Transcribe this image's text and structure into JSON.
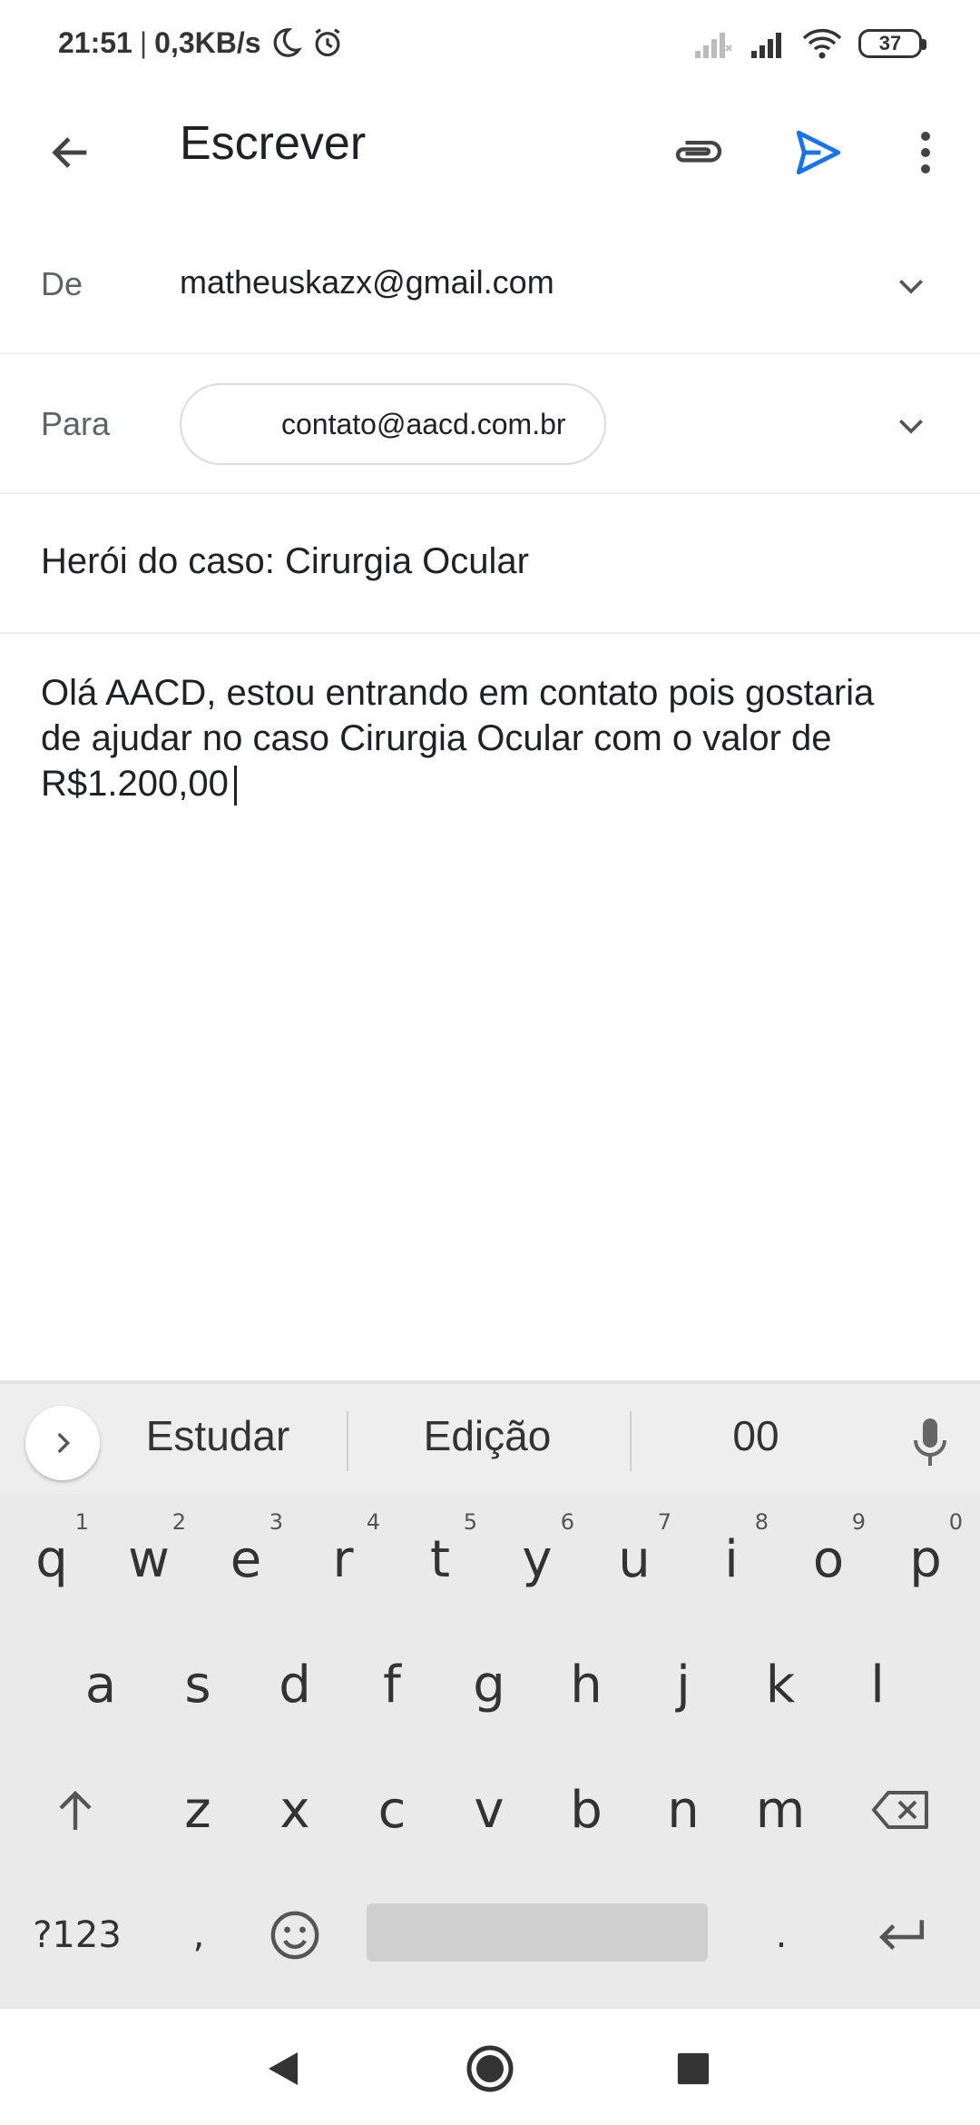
{
  "status_bar": {
    "time": "21:51",
    "separator": "|",
    "net_speed": "0,3KB/s",
    "battery": "37",
    "icons": [
      "moon-icon",
      "alarm-icon",
      "signal-off-icon",
      "signal-icon",
      "wifi-icon",
      "battery-icon"
    ]
  },
  "app_bar": {
    "title": "Escrever",
    "icons": [
      "back-arrow-icon",
      "paperclip-icon",
      "send-icon",
      "more-vert-icon"
    ],
    "send_color": "#1a73e8"
  },
  "compose": {
    "from_label": "De",
    "from_value": "matheuskazx@gmail.com",
    "to_label": "Para",
    "to_chip": "contato@aacd.com.br",
    "subject": "Herói do caso: Cirurgia Ocular",
    "body_line_1": "Olá AACD, estou entrando em contato pois gostaria",
    "body_line_2": "de ajudar no caso Cirurgia Ocular com o valor de",
    "body_line_3": "R$1.200,00"
  },
  "keyboard": {
    "suggestions": [
      "Estudar",
      "Edição",
      "00"
    ],
    "row1": [
      {
        "key": "q",
        "hint": "1"
      },
      {
        "key": "w",
        "hint": "2"
      },
      {
        "key": "e",
        "hint": "3"
      },
      {
        "key": "r",
        "hint": "4"
      },
      {
        "key": "t",
        "hint": "5"
      },
      {
        "key": "y",
        "hint": "6"
      },
      {
        "key": "u",
        "hint": "7"
      },
      {
        "key": "i",
        "hint": "8"
      },
      {
        "key": "o",
        "hint": "9"
      },
      {
        "key": "p",
        "hint": "0"
      }
    ],
    "row2": [
      "a",
      "s",
      "d",
      "f",
      "g",
      "h",
      "j",
      "k",
      "l"
    ],
    "row3": [
      "z",
      "x",
      "c",
      "v",
      "b",
      "n",
      "m"
    ],
    "symbols_key": "?123",
    "comma_key": ",",
    "period_key": "."
  },
  "nav_bar": {
    "icons": [
      "nav-back-icon",
      "nav-home-icon",
      "nav-recents-icon"
    ]
  }
}
